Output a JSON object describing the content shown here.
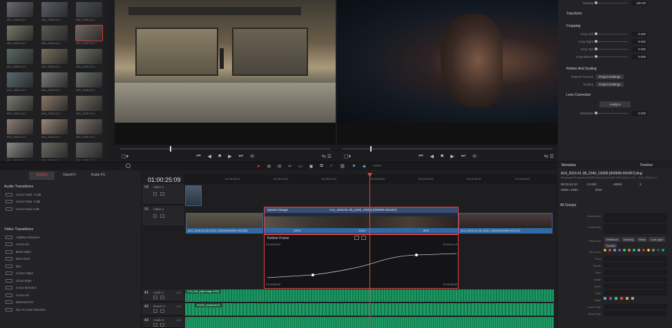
{
  "media_pool": {
    "clips": [
      {
        "label": "A01_2015-12-1",
        "scene": "#6b6b6e"
      },
      {
        "label": "A01_2015-12-1",
        "scene": "#5a5f66"
      },
      {
        "label": "A01_2015-12-1",
        "scene": "#4a4e53"
      },
      {
        "label": "A01_2015-12-1",
        "scene": "#7b7766"
      },
      {
        "label": "A01_2015-12-1",
        "scene": "#5c5850"
      },
      {
        "label": "A01_2015-12-1",
        "scene": "#6e6a63"
      },
      {
        "label": "A01_2015-12-1",
        "scene": "#5a6a63"
      },
      {
        "label": "A01_2015-12-1",
        "scene": "#7a6f5b"
      },
      {
        "label": "A01_2015-12-1",
        "scene": "#6e6e62"
      },
      {
        "label": "A01_2015-12-1",
        "scene": "#5a6a70"
      },
      {
        "label": "A01_2015-12-1",
        "scene": "#7d7f7a"
      },
      {
        "label": "A01_2015-12-1",
        "scene": "#6b7269"
      },
      {
        "label": "A01_2015-12-1",
        "scene": "#7d7a72"
      },
      {
        "label": "A01_2015-12-1",
        "scene": "#8a7a68"
      },
      {
        "label": "A01_2015-12-1",
        "scene": "#6f6a60"
      },
      {
        "label": "A01_2015-12-1",
        "scene": "#8c7e74"
      },
      {
        "label": "A01_2015-12-1",
        "scene": "#9a8a76"
      },
      {
        "label": "A01_2015-12-1",
        "scene": "#7a7064"
      },
      {
        "label": "A01_2015-12-1",
        "scene": "#8a8a86"
      },
      {
        "label": "A01_2015-12-1",
        "scene": "#6b6a62"
      },
      {
        "label": "A01_2015-12-1",
        "scene": "#5d5f5c"
      }
    ]
  },
  "inspector": {
    "opacity_label": "Opacity",
    "opacity_value": "100.00",
    "transform": "Transform",
    "cropping": "Cropping",
    "crop_rows": [
      {
        "name": "Crop Left",
        "value": "0.000"
      },
      {
        "name": "Crop Right",
        "value": "0.000"
      },
      {
        "name": "Crop Top",
        "value": "0.000"
      },
      {
        "name": "Crop Bottom",
        "value": "0.000"
      }
    ],
    "retime_scaling": "Retime And Scaling",
    "retime_process_label": "Retime Process",
    "retime_process_value": "Project Settings",
    "scaling_label": "Scaling",
    "scaling_value": "Project Settings",
    "lens_correction": "Lens Correction",
    "analyze": "Analyze",
    "distortion_label": "Distortion",
    "distortion_value": "0.000"
  },
  "toolbox": {
    "tabs": [
      "Toolbox",
      "OpenFX",
      "Audio FX"
    ],
    "audio_transitions_title": "Audio Transitions",
    "audio_transitions": [
      "Cross Fade +3 dB",
      "Cross Fade -3 dB",
      "Cross Fade 0 dB"
    ],
    "video_transitions_title": "Video Transitions",
    "video_transitions": [
      "Additive Dissolve",
      "Arrow Iris",
      "Band Wipe",
      "Barn Door",
      "Box",
      "Center Wipe",
      "Clock Wipe",
      "Cross Dissolve",
      "Cross Iris",
      "Diamond Iris",
      "Dip To Color Dissolve"
    ]
  },
  "timeline": {
    "timecode": "01:00:25:09",
    "ruler_ticks": [
      "01:00:18:13",
      "01:00:19:13",
      "01:00:22:20",
      "01:00:25:00",
      "01:00:29:03",
      "01:00:32:07",
      "01:00:35:10"
    ],
    "tracks": [
      {
        "id": "V2",
        "name": "Video 2"
      },
      {
        "id": "V1",
        "name": "Video 1"
      },
      {
        "id": "A1",
        "name": "Audio 1",
        "level": "2.0"
      },
      {
        "id": "A2",
        "name": "Reach 5",
        "level": "2.0"
      },
      {
        "id": "A3",
        "name": "Audio 4",
        "level": "2.0"
      }
    ],
    "speed_change_title": "Speed Change",
    "speed_clip_name": "A14_2016-01-28_2240_C0005 [000000-002457]",
    "v1_left_clip": "A14_2016-01-28_2212_C0005 [000000-001502]",
    "v1_right_clip": "A14_2016-01-28_2302_C0008 [000000-001127]",
    "speed_pcts": [
      "100%",
      "111%",
      "63%"
    ],
    "retime_frame_title": "Retime Frame",
    "retime_tc_top_left": "23:43:49:19",
    "retime_tc_top_right": "23:43:44:19",
    "retime_tc_bottom_left": "23:43:58:00",
    "retime_tc_bottom_right": "23:49:58:00",
    "audio_clips": [
      "3:18_full_p8g-image 3190",
      "30432_blurbeat-01"
    ]
  },
  "metadata": {
    "tab_metadata": "Metadata",
    "tab_timeline": "Timeline",
    "clip_name": "A14_2016-01-28_2240_C0005 [000000-002457].dng",
    "clip_sub": "Wholesale Production AMIRA Mini-ALEXA Mini 4KS 2016-01-28 ... A14_2016-01-2",
    "info": [
      "00:03:42:10",
      "24.000",
      "48000",
      "2",
      "4608 x 2592",
      "DNG"
    ],
    "all_groups": "All Groups",
    "field_labels": [
      "Description",
      "Comments",
      "Keywords",
      "Clip Color",
      "Shot",
      "Scene",
      "Take",
      "Angle",
      "Move",
      "Take",
      "Flags",
      "Good Take",
      "Shoot Day"
    ],
    "keywords": [
      "Wetlands",
      "Drawing",
      "Birds",
      "Low Light",
      "Sunset"
    ],
    "clip_colors": [
      "#e8a33a",
      "#d64545",
      "#5aa0d8",
      "#8e44ad",
      "#2ecc71",
      "#e67e22",
      "#1abc9c",
      "#95a5a6",
      "#c0392b",
      "#f1c40f",
      "#7f8c8d",
      "#34495e",
      "#16a085"
    ],
    "flag_colors": [
      "#5aa0d8",
      "#8e44ad",
      "#2ecc71",
      "#d64545",
      "#e8a33a",
      "#95a5a6"
    ]
  }
}
